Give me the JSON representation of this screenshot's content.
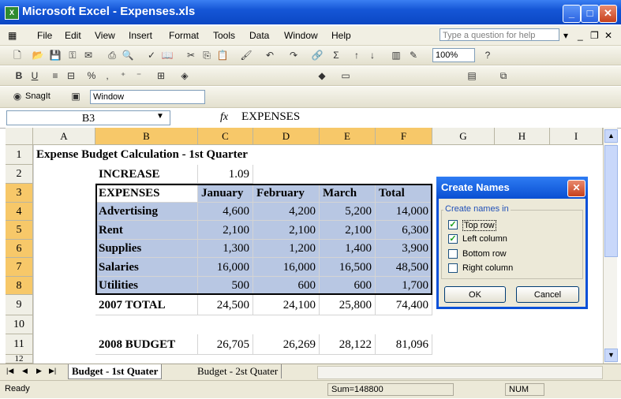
{
  "window": {
    "title": "Microsoft Excel - Expenses.xls",
    "app_icon": "excel-icon"
  },
  "menu": {
    "items": [
      "File",
      "Edit",
      "View",
      "Insert",
      "Format",
      "Tools",
      "Data",
      "Window",
      "Help"
    ],
    "help_placeholder": "Type a question for help"
  },
  "toolbar": {
    "zoom": "100%",
    "snagit_label": "SnagIt",
    "snagit_window": "Window",
    "sum_symbol": "Σ"
  },
  "formula_bar": {
    "name_box": "B3",
    "fx": "fx",
    "content": "EXPENSES"
  },
  "grid": {
    "columns": [
      "A",
      "B",
      "C",
      "D",
      "E",
      "F",
      "G",
      "H",
      "I"
    ],
    "rows": [
      "1",
      "2",
      "3",
      "4",
      "5",
      "6",
      "7",
      "8",
      "9",
      "10",
      "11",
      "12"
    ],
    "title": "Expense Budget Calculation - 1st Quarter",
    "increase_label": "INCREASE",
    "increase_value": "1.09",
    "header": [
      "EXPENSES",
      "January",
      "February",
      "March",
      "Total"
    ],
    "data": [
      [
        "Advertising",
        "4,600",
        "4,200",
        "5,200",
        "14,000"
      ],
      [
        "Rent",
        "2,100",
        "2,100",
        "2,100",
        "6,300"
      ],
      [
        "Supplies",
        "1,300",
        "1,200",
        "1,400",
        "3,900"
      ],
      [
        "Salaries",
        "16,000",
        "16,000",
        "16,500",
        "48,500"
      ],
      [
        "Utilities",
        "500",
        "600",
        "600",
        "1,700"
      ]
    ],
    "total_row": [
      "2007 TOTAL",
      "24,500",
      "24,100",
      "25,800",
      "74,400"
    ],
    "budget_row": [
      "2008 BUDGET",
      "26,705",
      "26,269",
      "28,122",
      "81,096"
    ]
  },
  "dialog": {
    "title": "Create Names",
    "group_label": "Create names in",
    "options": [
      {
        "label": "Top row",
        "checked": true
      },
      {
        "label": "Left column",
        "checked": true
      },
      {
        "label": "Bottom row",
        "checked": false
      },
      {
        "label": "Right column",
        "checked": false
      }
    ],
    "ok": "OK",
    "cancel": "Cancel"
  },
  "sheets": {
    "tabs": [
      "Budget - 1st Quater",
      "Budget - 2st Quater"
    ],
    "active": 0
  },
  "status": {
    "ready": "Ready",
    "sum": "Sum=148800",
    "num": "NUM"
  }
}
